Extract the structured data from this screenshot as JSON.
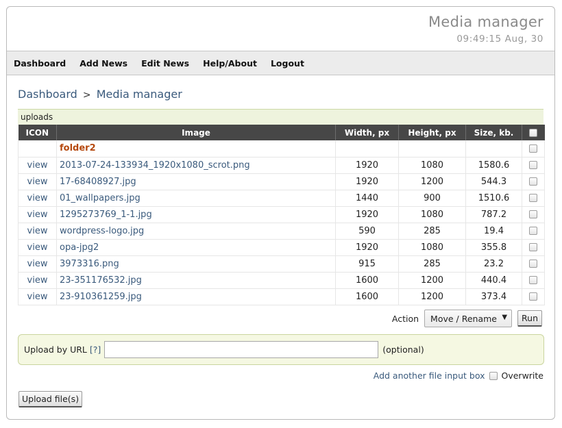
{
  "header": {
    "title": "Media manager",
    "clock": "09:49:15 Aug, 30"
  },
  "nav": [
    {
      "label": "Dashboard"
    },
    {
      "label": "Add News"
    },
    {
      "label": "Edit News"
    },
    {
      "label": "Help/About"
    },
    {
      "label": "Logout"
    }
  ],
  "breadcrumb": {
    "root": "Dashboard",
    "separator": ">",
    "current": "Media manager"
  },
  "path": "uploads",
  "table": {
    "headers": [
      "ICON",
      "Image",
      "Width, px",
      "Height, px",
      "Size, kb."
    ],
    "folder": {
      "name": "folder2"
    },
    "view_label": "view",
    "rows": [
      {
        "name": "2013-07-24-133934_1920x1080_scrot.png",
        "width": "1920",
        "height": "1080",
        "size": "1580.6"
      },
      {
        "name": "17-68408927.jpg",
        "width": "1920",
        "height": "1200",
        "size": "544.3"
      },
      {
        "name": "01_wallpapers.jpg",
        "width": "1440",
        "height": "900",
        "size": "1510.6"
      },
      {
        "name": "1295273769_1-1.jpg",
        "width": "1920",
        "height": "1080",
        "size": "787.2"
      },
      {
        "name": "wordpress-logo.jpg",
        "width": "590",
        "height": "285",
        "size": "19.4"
      },
      {
        "name": "opa-jpg2",
        "width": "1920",
        "height": "1080",
        "size": "355.8"
      },
      {
        "name": "3973316.png",
        "width": "915",
        "height": "285",
        "size": "23.2"
      },
      {
        "name": "23-351176532.jpg",
        "width": "1600",
        "height": "1200",
        "size": "440.4"
      },
      {
        "name": "23-910361259.jpg",
        "width": "1600",
        "height": "1200",
        "size": "373.4"
      }
    ]
  },
  "action": {
    "label": "Action",
    "selected": "Move / Rename",
    "run_label": "Run"
  },
  "upload_url": {
    "label": "Upload by URL",
    "help": "[?]",
    "value": "",
    "optional": "(optional)"
  },
  "add_input": {
    "link": "Add another file input box",
    "overwrite": "Overwrite"
  },
  "upload_button": "Upload file(s)"
}
